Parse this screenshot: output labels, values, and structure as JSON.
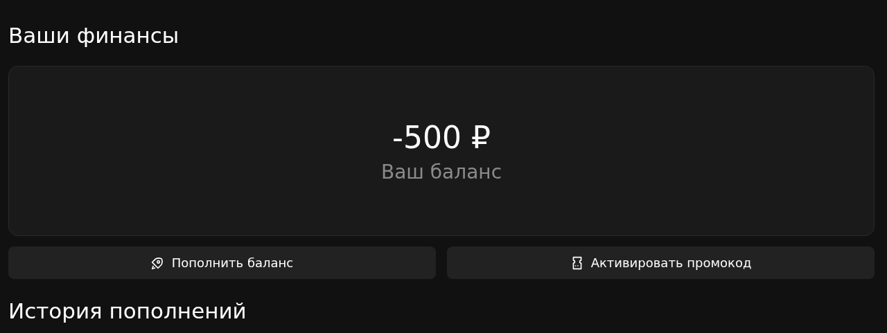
{
  "title": "Ваши финансы",
  "balance": {
    "amount": "-500 ₽",
    "label": "Ваш баланс"
  },
  "buttons": [
    {
      "label": "Пополнить баланс",
      "kind": "topup"
    },
    {
      "label": "Активировать промокод",
      "kind": "promo"
    }
  ],
  "history": {
    "title": "История пополнений"
  }
}
